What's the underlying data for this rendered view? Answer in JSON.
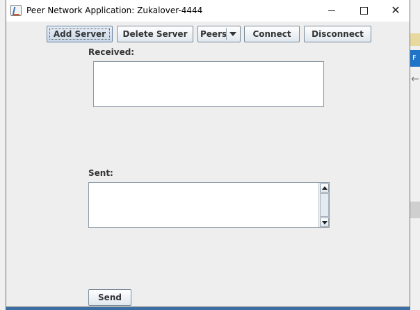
{
  "window": {
    "title": "Peer Network Application: Zukalover-4444"
  },
  "toolbar": {
    "add_server_label": "Add Server",
    "delete_server_label": "Delete Server",
    "peers_combo_value": "Peers",
    "connect_label": "Connect",
    "disconnect_label": "Disconnect"
  },
  "received": {
    "label": "Received:",
    "value": ""
  },
  "sent": {
    "label": "Sent:",
    "value": ""
  },
  "send_label": "Send",
  "background": {
    "right_tab_letter": "F"
  },
  "icons": {
    "app": "java-app-icon",
    "minimize": "minimize-icon",
    "maximize": "maximize-icon",
    "close": "close-icon",
    "combo": "chevron-down-icon",
    "scroll_up": "scroll-up-icon",
    "scroll_down": "scroll-down-icon"
  },
  "colors": {
    "window_bg": "#eeeeee",
    "button_border": "#7a8a99"
  }
}
